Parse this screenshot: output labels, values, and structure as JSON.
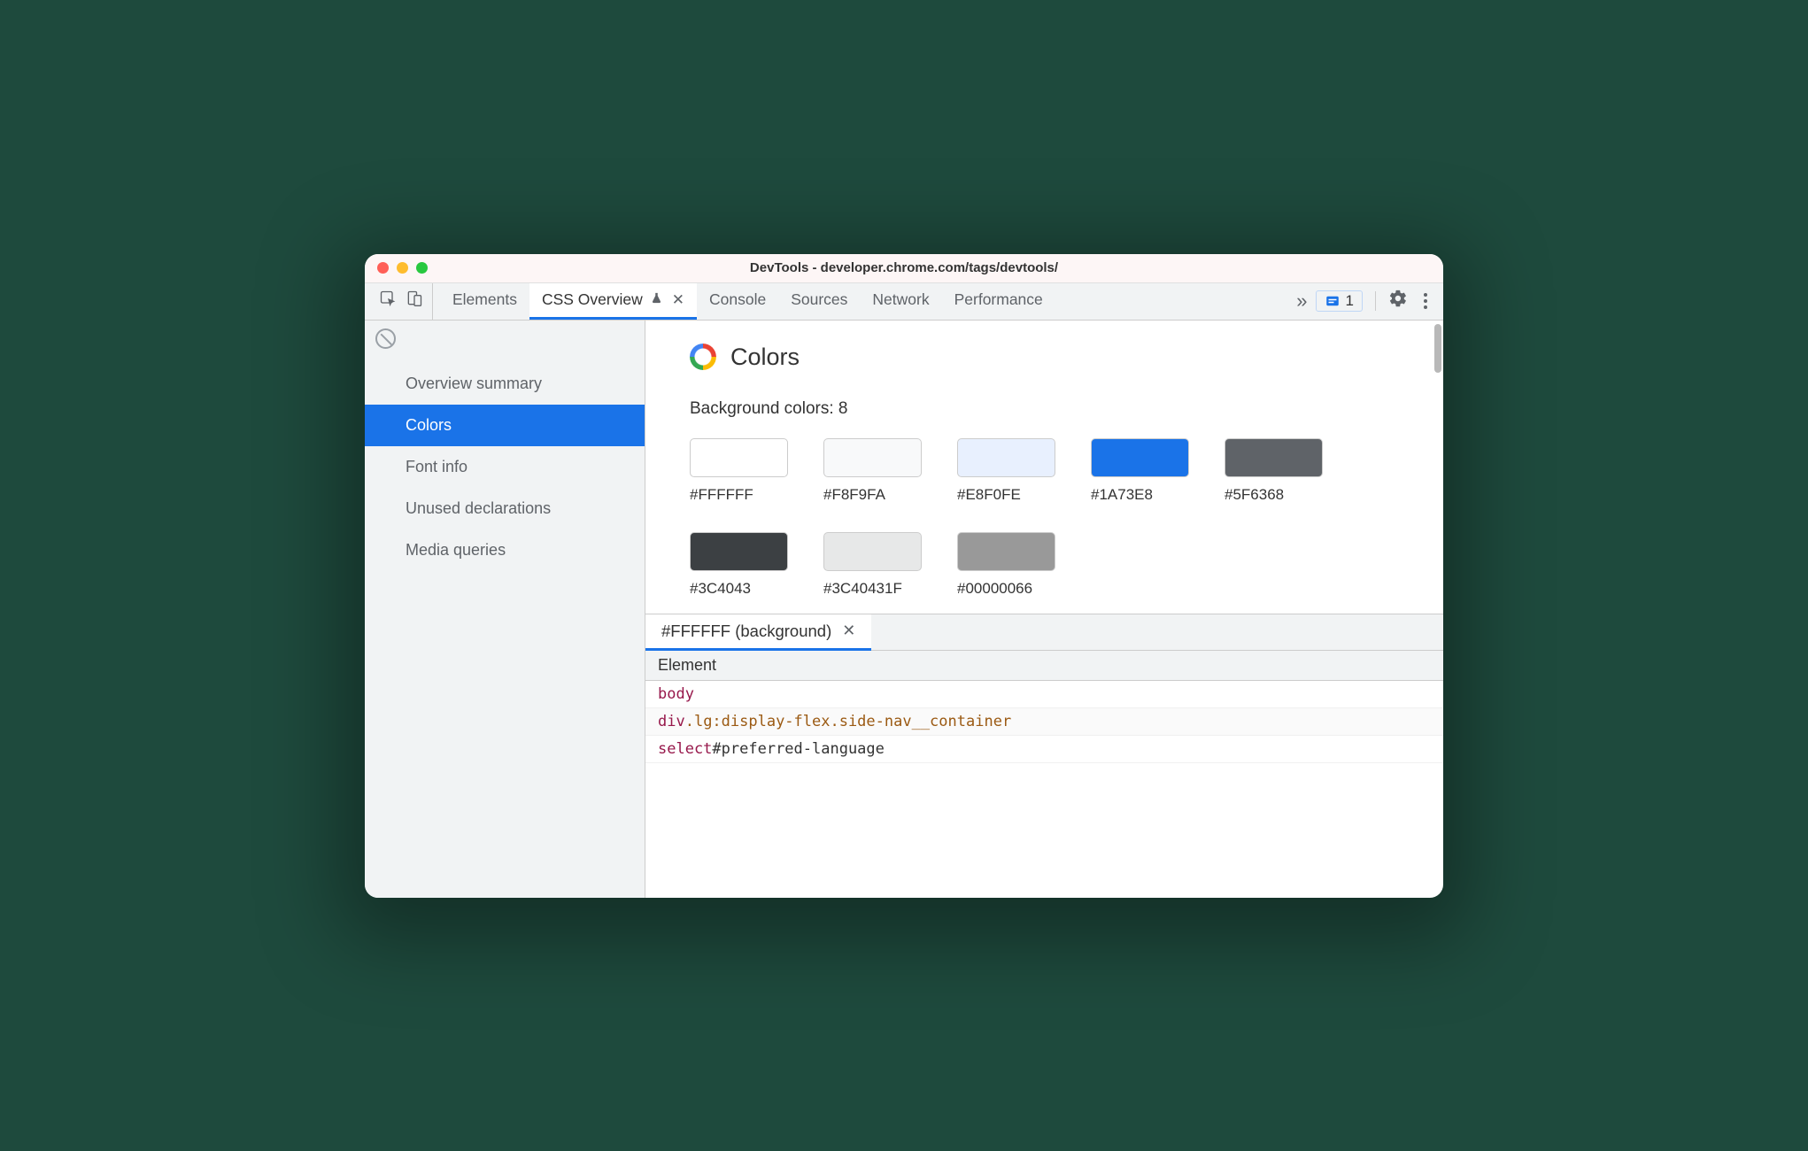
{
  "window": {
    "title": "DevTools - developer.chrome.com/tags/devtools/"
  },
  "tabs": {
    "items": [
      "Elements",
      "CSS Overview",
      "Console",
      "Sources",
      "Network",
      "Performance"
    ],
    "active_index": 1,
    "issues_count": "1"
  },
  "sidebar": {
    "items": [
      "Overview summary",
      "Colors",
      "Font info",
      "Unused declarations",
      "Media queries"
    ],
    "selected_index": 1
  },
  "section": {
    "title": "Colors",
    "bg_colors_label": "Background colors: 8",
    "swatches": [
      {
        "hex": "#FFFFFF",
        "css": "#FFFFFF"
      },
      {
        "hex": "#F8F9FA",
        "css": "#F8F9FA"
      },
      {
        "hex": "#E8F0FE",
        "css": "#E8F0FE"
      },
      {
        "hex": "#1A73E8",
        "css": "#1A73E8"
      },
      {
        "hex": "#5F6368",
        "css": "#5F6368"
      },
      {
        "hex": "#3C4043",
        "css": "#3C4043"
      },
      {
        "hex": "#3C40431F",
        "css": "rgba(60,64,67,0.12)"
      },
      {
        "hex": "#00000066",
        "css": "rgba(0,0,0,0.40)"
      }
    ]
  },
  "details": {
    "tab_label": "#FFFFFF (background)",
    "column_header": "Element",
    "rows": [
      [
        {
          "t": "tag",
          "v": "body"
        }
      ],
      [
        {
          "t": "tag",
          "v": "div"
        },
        {
          "t": "class",
          "v": ".lg:display-flex.side-nav__container"
        }
      ],
      [
        {
          "t": "tag",
          "v": "select"
        },
        {
          "t": "id",
          "v": "#preferred-language"
        }
      ]
    ]
  }
}
